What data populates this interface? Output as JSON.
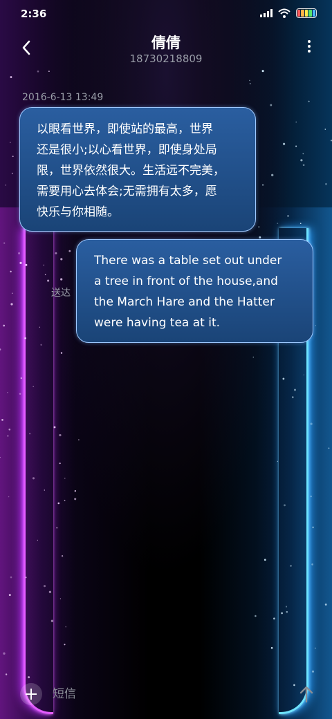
{
  "status_bar": {
    "time": "2:36",
    "icons": [
      "signal-icon",
      "wifi-icon",
      "battery-icon"
    ],
    "battery_colors": [
      "#ff5a5a",
      "#ffb347",
      "#ffe84d",
      "#59e36b",
      "#4db8ff"
    ]
  },
  "header": {
    "back_icon": "chevron-left-icon",
    "title": "倩倩",
    "subtitle": "18730218809",
    "more_icon": "more-vertical-icon"
  },
  "conversation": {
    "timestamp": "2016-6-13 13:49",
    "messages": [
      {
        "direction": "incoming",
        "lines": [
          "以眼看世界，即使站的最高，世界",
          "还是很小;以心看世界，即使身处局",
          "限，世界依然很大。生活远不完美，",
          "需要用心去体会;无需拥有太多，愿",
          "快乐与你相随。"
        ]
      },
      {
        "direction": "outgoing",
        "lines": [
          "There was a table set out under",
          "a tree in front of the house,and",
          "the March Hare and the Hatter",
          "were having tea at it."
        ],
        "status": "送达"
      }
    ]
  },
  "composer": {
    "add_icon": "plus-icon",
    "placeholder": "短信",
    "send_icon": "arrow-up-icon"
  },
  "colors": {
    "bubble_fill": "#1f4f8a",
    "bubble_border": "#9ec9ff",
    "neon_left": "#e35cff",
    "neon_right": "#6ee3ff"
  }
}
